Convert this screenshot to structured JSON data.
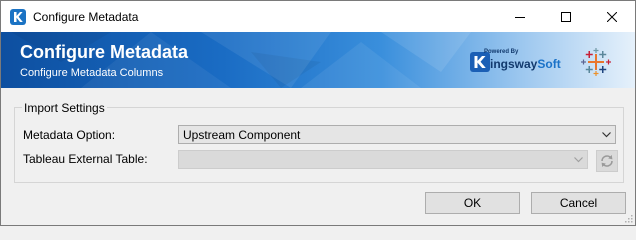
{
  "window": {
    "title": "Configure Metadata",
    "icon": "kingswaysoft-app-icon"
  },
  "title_controls": {
    "minimize": "minimize-icon",
    "maximize": "maximize-icon",
    "close": "close-icon"
  },
  "banner": {
    "title": "Configure Metadata",
    "subtitle": "Configure Metadata Columns",
    "brand_powered": "Powered By",
    "brand_name_prefix": "ingsway",
    "brand_name_suffix": "Soft",
    "tableau_icon": "tableau-logo-icon"
  },
  "import_settings": {
    "legend": "Import Settings",
    "metadata_option": {
      "label": "Metadata Option:",
      "value": "Upstream Component"
    },
    "tableau_external_table": {
      "label": "Tableau External Table:",
      "value": "",
      "enabled": false
    },
    "refresh_icon": "refresh-icon"
  },
  "buttons": {
    "ok": "OK",
    "cancel": "Cancel"
  }
}
